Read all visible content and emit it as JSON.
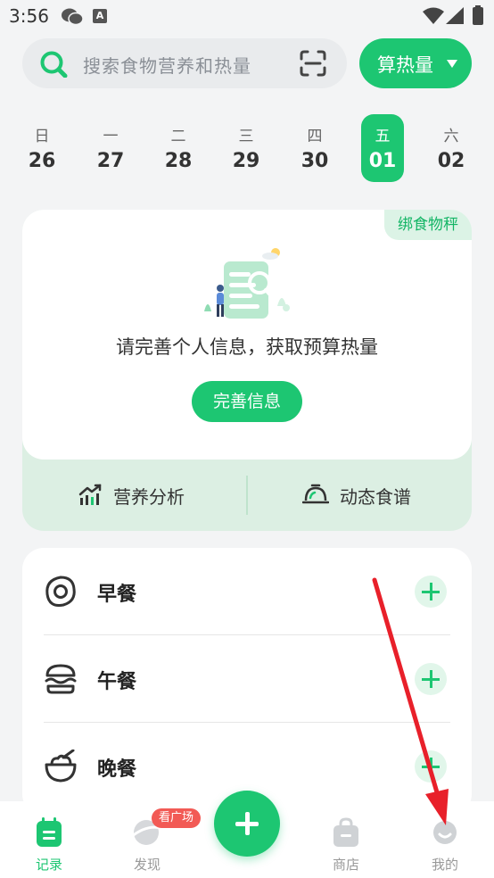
{
  "status_bar": {
    "time": "3:56",
    "notification_letter": "A"
  },
  "search": {
    "placeholder": "搜索食物营养和热量"
  },
  "calc_button": {
    "label": "算热量"
  },
  "week": [
    {
      "weekday": "日",
      "date": "26",
      "active": false
    },
    {
      "weekday": "一",
      "date": "27",
      "active": false
    },
    {
      "weekday": "二",
      "date": "28",
      "active": false
    },
    {
      "weekday": "三",
      "date": "29",
      "active": false
    },
    {
      "weekday": "四",
      "date": "30",
      "active": false
    },
    {
      "weekday": "五",
      "date": "01",
      "active": true
    },
    {
      "weekday": "六",
      "date": "02",
      "active": false
    }
  ],
  "info_card": {
    "scale_tag": "绑食物秤",
    "prompt": "请完善个人信息，获取预算热量",
    "complete_button": "完善信息",
    "nutrition_analysis": "营养分析",
    "dynamic_recipe": "动态食谱"
  },
  "meals": [
    {
      "label": "早餐",
      "icon": "fried-egg-icon"
    },
    {
      "label": "午餐",
      "icon": "burger-icon"
    },
    {
      "label": "晚餐",
      "icon": "rice-bowl-icon"
    }
  ],
  "nav": {
    "record": "记录",
    "discover": "发现",
    "discover_badge": "看广场",
    "shop": "商店",
    "mine": "我的"
  },
  "colors": {
    "accent": "#1dc672",
    "badge": "#f25a55",
    "annotation_arrow": "#e8202a"
  }
}
